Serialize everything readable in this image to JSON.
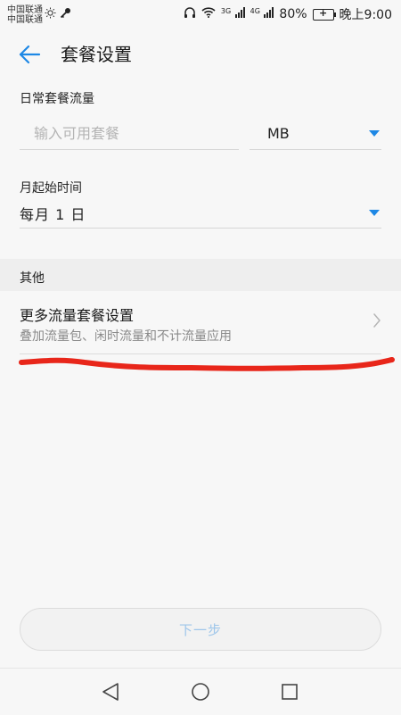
{
  "status_bar": {
    "carrier_1": "中国联通",
    "carrier_2": "中国联通",
    "network_3g": "3G",
    "network_4g": "4G",
    "battery": "80%",
    "time": "晚上9:00"
  },
  "header": {
    "title": "套餐设置",
    "accent_color": "#1e88e5"
  },
  "daily_quota": {
    "label": "日常套餐流量",
    "input_value": "",
    "input_placeholder": "输入可用套餐",
    "unit_value": "MB"
  },
  "month_start": {
    "label": "月起始时间",
    "value": "每月 1 日"
  },
  "other_section": {
    "header": "其他",
    "more_title": "更多流量套餐设置",
    "more_subtitle": "叠加流量包、闲时流量和不计流量应用"
  },
  "footer": {
    "next_label": "下一步"
  },
  "annotation": {
    "stroke_color": "#e8261a"
  }
}
